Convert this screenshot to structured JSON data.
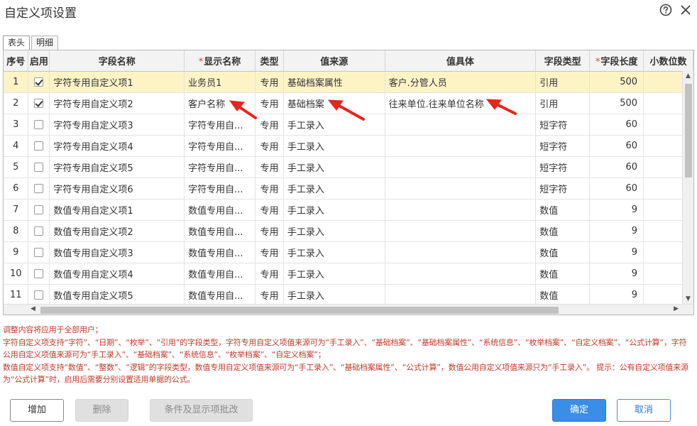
{
  "window": {
    "title": "自定义项设置"
  },
  "tabs": [
    {
      "label": "表头",
      "active": true
    },
    {
      "label": "明细",
      "active": false
    }
  ],
  "table": {
    "columns": [
      {
        "label": "序号",
        "required": false
      },
      {
        "label": "启用",
        "required": false
      },
      {
        "label": "字段名称",
        "required": false
      },
      {
        "label": "显示名称",
        "required": true
      },
      {
        "label": "类型",
        "required": false
      },
      {
        "label": "值来源",
        "required": false
      },
      {
        "label": "值具体",
        "required": false
      },
      {
        "label": "字段类型",
        "required": false
      },
      {
        "label": "字段长度",
        "required": true
      },
      {
        "label": "小数位数",
        "required": false
      }
    ],
    "rows": [
      {
        "no": "1",
        "enabled": true,
        "field_name": "字符专用自定义项1",
        "display_name": "业务员1",
        "type": "专用",
        "value_source": "基础档案属性",
        "value_detail": "客户.分管人员",
        "field_type": "引用",
        "length": "500",
        "decimals": "",
        "selected": true
      },
      {
        "no": "2",
        "enabled": true,
        "field_name": "字符专用自定义项2",
        "display_name": "客户名称",
        "type": "专用",
        "value_source": "基础档案",
        "value_detail": "往来单位.往来单位名称",
        "field_type": "引用",
        "length": "500",
        "decimals": ""
      },
      {
        "no": "3",
        "enabled": false,
        "field_name": "字符专用自定义项3",
        "display_name": "字符专用自...",
        "type": "专用",
        "value_source": "手工录入",
        "value_detail": "",
        "field_type": "短字符",
        "length": "60",
        "decimals": ""
      },
      {
        "no": "4",
        "enabled": false,
        "field_name": "字符专用自定义项4",
        "display_name": "字符专用自...",
        "type": "专用",
        "value_source": "手工录入",
        "value_detail": "",
        "field_type": "短字符",
        "length": "60",
        "decimals": ""
      },
      {
        "no": "5",
        "enabled": false,
        "field_name": "字符专用自定义项5",
        "display_name": "字符专用自...",
        "type": "专用",
        "value_source": "手工录入",
        "value_detail": "",
        "field_type": "短字符",
        "length": "60",
        "decimals": ""
      },
      {
        "no": "6",
        "enabled": false,
        "field_name": "字符专用自定义项6",
        "display_name": "字符专用自...",
        "type": "专用",
        "value_source": "手工录入",
        "value_detail": "",
        "field_type": "短字符",
        "length": "60",
        "decimals": ""
      },
      {
        "no": "7",
        "enabled": false,
        "field_name": "数值专用自定义项1",
        "display_name": "数值专用自...",
        "type": "专用",
        "value_source": "手工录入",
        "value_detail": "",
        "field_type": "数值",
        "length": "9",
        "decimals": ""
      },
      {
        "no": "8",
        "enabled": false,
        "field_name": "数值专用自定义项2",
        "display_name": "数值专用自...",
        "type": "专用",
        "value_source": "手工录入",
        "value_detail": "",
        "field_type": "数值",
        "length": "9",
        "decimals": ""
      },
      {
        "no": "9",
        "enabled": false,
        "field_name": "数值专用自定义项3",
        "display_name": "数值专用自...",
        "type": "专用",
        "value_source": "手工录入",
        "value_detail": "",
        "field_type": "数值",
        "length": "9",
        "decimals": ""
      },
      {
        "no": "10",
        "enabled": false,
        "field_name": "数值专用自定义项4",
        "display_name": "数值专用自...",
        "type": "专用",
        "value_source": "手工录入",
        "value_detail": "",
        "field_type": "数值",
        "length": "9",
        "decimals": ""
      },
      {
        "no": "11",
        "enabled": false,
        "field_name": "数值专用自定义项5",
        "display_name": "数值专用自...",
        "type": "专用",
        "value_source": "手工录入",
        "value_detail": "",
        "field_type": "数值",
        "length": "9",
        "decimals": ""
      }
    ]
  },
  "notes": {
    "line1": "调整内容将应用于全部用户；",
    "line2": "字符自定义项支持“字符”、“日期”、“枚举”、“引用”的字段类型，字符专用自定义项值来源可为“手工录入”、“基础档案”、“基础档案属性”、“系统信息”、“枚举档案”、“自定义档案”、“公式计算”，字符公用自定义项值来源可为“手工录入”、“基础档案”、“系统信息”、“枚举档案”、“自定义档案”；",
    "line3": "数值自定义项支持“数值”、“整数”、“逻辑”的字段类型，数值专用自定义项值来源可为“手工录入”、“基础档案属性”、“公式计算”，数值公用自定义项值来源只为“手工录入”。 提示：公有自定义项值来源为“公式计算”时，启用后需要分别设置适用单据的公式。"
  },
  "buttons": {
    "add": "增加",
    "delete": "删除",
    "batch": "条件及显示项批改",
    "ok": "确定",
    "cancel": "取消"
  },
  "colors": {
    "note_text": "#c0392b",
    "selected_row": "#fdf4c6",
    "primary_button": "#3a8ee6",
    "annotation_arrow": "#e8241c"
  }
}
